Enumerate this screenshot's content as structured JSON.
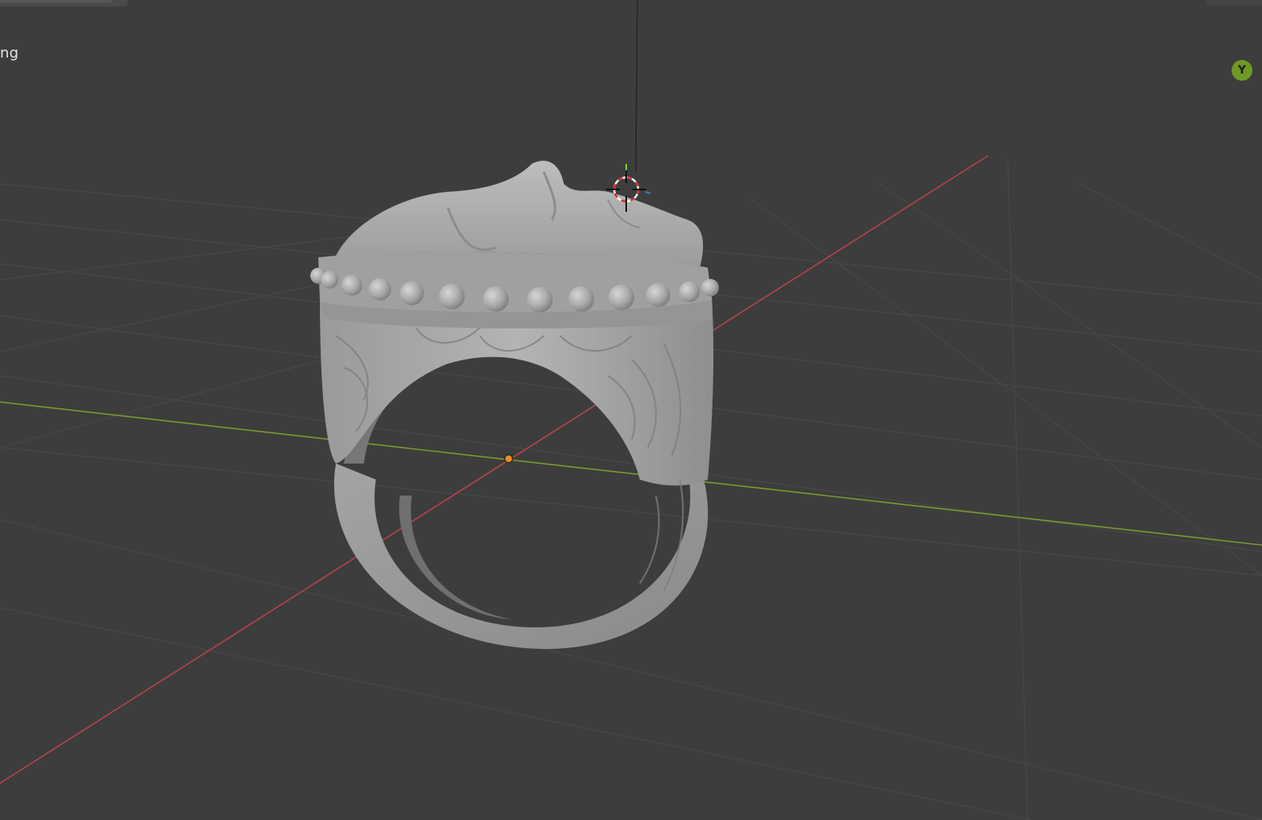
{
  "viewport": {
    "overlay_text": "ng",
    "background_color": "#3d3d3d"
  },
  "gizmo": {
    "y_axis_label": "Y",
    "y_axis_color": "#6e9a23"
  },
  "axes": {
    "x_axis_color": "#b8434b",
    "y_axis_color": "#7a9b2e"
  },
  "origin_marker_color": "#f08a1d",
  "object": {
    "material_color": "#a8a8a8"
  }
}
